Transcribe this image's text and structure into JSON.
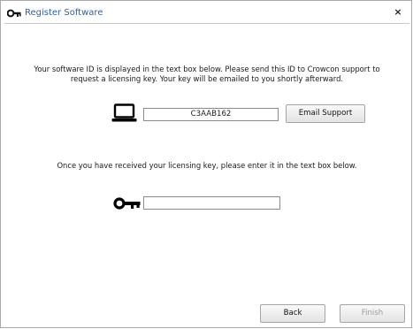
{
  "window": {
    "title": "Register Software",
    "title_icon": "key-icon",
    "close_label": "×"
  },
  "info": {
    "line1": "Your software ID is displayed in the text box below.  Please send this ID to Crowcon support to",
    "line2": "request a licensing key.  Your key will be emailed to you shortly afterward."
  },
  "software_id": {
    "icon": "laptop-icon",
    "value": "C3AAB162"
  },
  "email_support_label": "Email Support",
  "license": {
    "instruction": "Once you have received your licensing key, please enter it in the text box below.",
    "icon": "key-icon",
    "value": ""
  },
  "footer": {
    "back_label": "Back",
    "finish_label": "Finish"
  },
  "colors": {
    "title_text": "#2f5ea8",
    "disabled_text": "#9c9c9c"
  }
}
